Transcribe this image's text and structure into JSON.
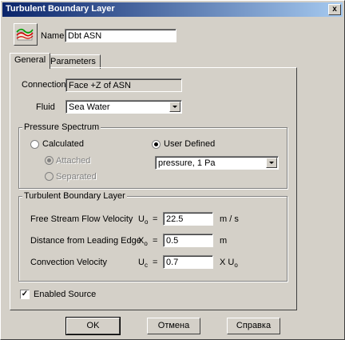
{
  "window": {
    "title": "Turbulent Boundary Layer",
    "close_glyph": "x"
  },
  "header": {
    "name_label": "Name",
    "name_value": "Dbt ASN"
  },
  "tabs": [
    {
      "label": "General",
      "active": true
    },
    {
      "label": "Parameters",
      "active": false
    }
  ],
  "general": {
    "connection_label": "Connection",
    "connection_value": "Face +Z of ASN",
    "fluid_label": "Fluid",
    "fluid_value": "Sea Water"
  },
  "pressure_spectrum": {
    "title": "Pressure Spectrum",
    "calculated_label": "Calculated",
    "attached_label": "Attached",
    "separated_label": "Separated",
    "user_defined_label": "User Defined",
    "user_defined_value": "pressure, 1 Pa",
    "selected": "User Defined"
  },
  "tbl": {
    "title": "Turbulent Boundary Layer",
    "free_stream_label": "Free Stream Flow Velocity",
    "free_stream_symbol": "U",
    "free_stream_sub": "o",
    "free_stream_value": "22.5",
    "free_stream_unit": "m / s",
    "distance_label": "Distance from Leading Edge",
    "distance_symbol": "X",
    "distance_sub": "o",
    "distance_value": "0.5",
    "distance_unit": "m",
    "convection_label": "Convection Velocity",
    "convection_symbol": "U",
    "convection_sub": "c",
    "convection_value": "0.7",
    "convection_unit": "X U",
    "convection_unit_sub": "o",
    "equals": "="
  },
  "enabled_source": {
    "label": "Enabled Source",
    "checked": true,
    "check_glyph": "✓"
  },
  "buttons": {
    "ok": "OK",
    "cancel": "Отмена",
    "help": "Справка"
  },
  "colors": {
    "title_start": "#0a246a",
    "title_end": "#a6caf0",
    "face": "#d4d0c8"
  }
}
